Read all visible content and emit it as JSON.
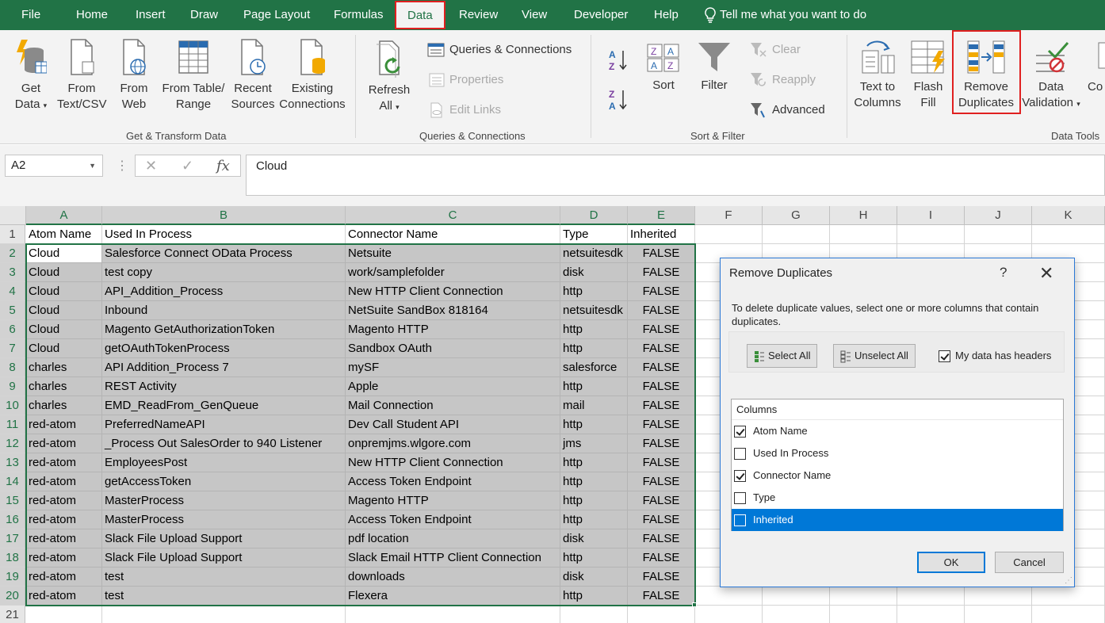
{
  "menu": {
    "file": "File",
    "home": "Home",
    "insert": "Insert",
    "draw": "Draw",
    "page_layout": "Page Layout",
    "formulas": "Formulas",
    "data": "Data",
    "review": "Review",
    "view": "View",
    "developer": "Developer",
    "help": "Help",
    "tell_me": "Tell me what you want to do"
  },
  "ribbon": {
    "get_data": [
      "Get",
      "Data"
    ],
    "from_text_csv": [
      "From",
      "Text/CSV"
    ],
    "from_web": [
      "From",
      "Web"
    ],
    "from_table": [
      "From Table/",
      "Range"
    ],
    "recent_sources": [
      "Recent",
      "Sources"
    ],
    "existing_connections": [
      "Existing",
      "Connections"
    ],
    "group_get_transform": "Get & Transform Data",
    "refresh_all": [
      "Refresh",
      "All"
    ],
    "queries_connections": "Queries & Connections",
    "properties": "Properties",
    "edit_links": "Edit Links",
    "group_queries": "Queries & Connections",
    "sort": "Sort",
    "filter": "Filter",
    "clear": "Clear",
    "reapply": "Reapply",
    "advanced": "Advanced",
    "group_sort_filter": "Sort & Filter",
    "text_to_columns": [
      "Text to",
      "Columns"
    ],
    "flash_fill": [
      "Flash",
      "Fill"
    ],
    "remove_duplicates": [
      "Remove",
      "Duplicates"
    ],
    "data_validation": [
      "Data",
      "Validation"
    ],
    "consolidate_partial": "Co",
    "group_data_tools": "Data Tools"
  },
  "formula_bar": {
    "name_box": "A2",
    "cancel": "✕",
    "enter": "✓",
    "fx": "fx",
    "content": "Cloud"
  },
  "sheet": {
    "columns": [
      "A",
      "B",
      "C",
      "D",
      "E",
      "F",
      "G",
      "H",
      "I",
      "J",
      "K"
    ],
    "row_numbers": [
      "1",
      "2",
      "3",
      "4",
      "5",
      "6",
      "7",
      "8",
      "9",
      "10",
      "11",
      "12",
      "13",
      "14",
      "15",
      "16",
      "17",
      "18",
      "19",
      "20",
      "21"
    ],
    "header_row": [
      "Atom Name",
      "Used In Process",
      "Connector Name",
      "Type",
      "Inherited"
    ],
    "rows": [
      [
        "Cloud",
        "Salesforce Connect OData Process",
        "Netsuite",
        "netsuitesdk",
        "FALSE"
      ],
      [
        "Cloud",
        "test copy",
        "work/samplefolder",
        "disk",
        "FALSE"
      ],
      [
        "Cloud",
        "API_Addition_Process",
        "New HTTP Client Connection",
        "http",
        "FALSE"
      ],
      [
        "Cloud",
        "Inbound",
        "NetSuite SandBox 818164",
        "netsuitesdk",
        "FALSE"
      ],
      [
        "Cloud",
        "Magento GetAuthorizationToken",
        "Magento HTTP",
        "http",
        "FALSE"
      ],
      [
        "Cloud",
        "getOAuthTokenProcess",
        "Sandbox OAuth",
        "http",
        "FALSE"
      ],
      [
        "charles",
        "API Addition_Process 7",
        "mySF",
        "salesforce",
        "FALSE"
      ],
      [
        "charles",
        "REST Activity",
        "Apple",
        "http",
        "FALSE"
      ],
      [
        "charles",
        "EMD_ReadFrom_GenQueue",
        "Mail Connection",
        "mail",
        "FALSE"
      ],
      [
        "red-atom",
        "PreferredNameAPI",
        "Dev Call Student API",
        "http",
        "FALSE"
      ],
      [
        "red-atom",
        "_Process Out SalesOrder to 940 Listener",
        "onpremjms.wlgore.com",
        "jms",
        "FALSE"
      ],
      [
        "red-atom",
        "EmployeesPost",
        "New HTTP Client Connection",
        "http",
        "FALSE"
      ],
      [
        "red-atom",
        "getAccessToken",
        "Access Token Endpoint",
        "http",
        "FALSE"
      ],
      [
        "red-atom",
        "MasterProcess",
        "Magento HTTP",
        "http",
        "FALSE"
      ],
      [
        "red-atom",
        "MasterProcess",
        "Access Token Endpoint",
        "http",
        "FALSE"
      ],
      [
        "red-atom",
        "Slack File Upload Support",
        "pdf location",
        "disk",
        "FALSE"
      ],
      [
        "red-atom",
        "Slack File Upload Support",
        "Slack Email HTTP Client Connection",
        "http",
        "FALSE"
      ],
      [
        "red-atom",
        "test",
        "downloads",
        "disk",
        "FALSE"
      ],
      [
        "red-atom",
        "test",
        "Flexera",
        "http",
        "FALSE"
      ]
    ]
  },
  "dialog": {
    "title": "Remove Duplicates",
    "help": "?",
    "close": "✕",
    "instructions": "To delete duplicate values, select one or more columns that contain duplicates.",
    "select_all": "Select All",
    "unselect_all": "Unselect All",
    "my_data_has_headers": "My data has headers",
    "my_data_has_headers_checked": true,
    "columns_header": "Columns",
    "columns": [
      {
        "label": "Atom Name",
        "checked": true
      },
      {
        "label": "Used In Process",
        "checked": false
      },
      {
        "label": "Connector Name",
        "checked": true
      },
      {
        "label": "Type",
        "checked": false
      },
      {
        "label": "Inherited",
        "checked": false,
        "highlighted": true
      }
    ],
    "ok": "OK",
    "cancel": "Cancel"
  },
  "colors": {
    "excel_green": "#217346",
    "highlight_red": "#e02020",
    "selection_blue": "#0078d7"
  }
}
